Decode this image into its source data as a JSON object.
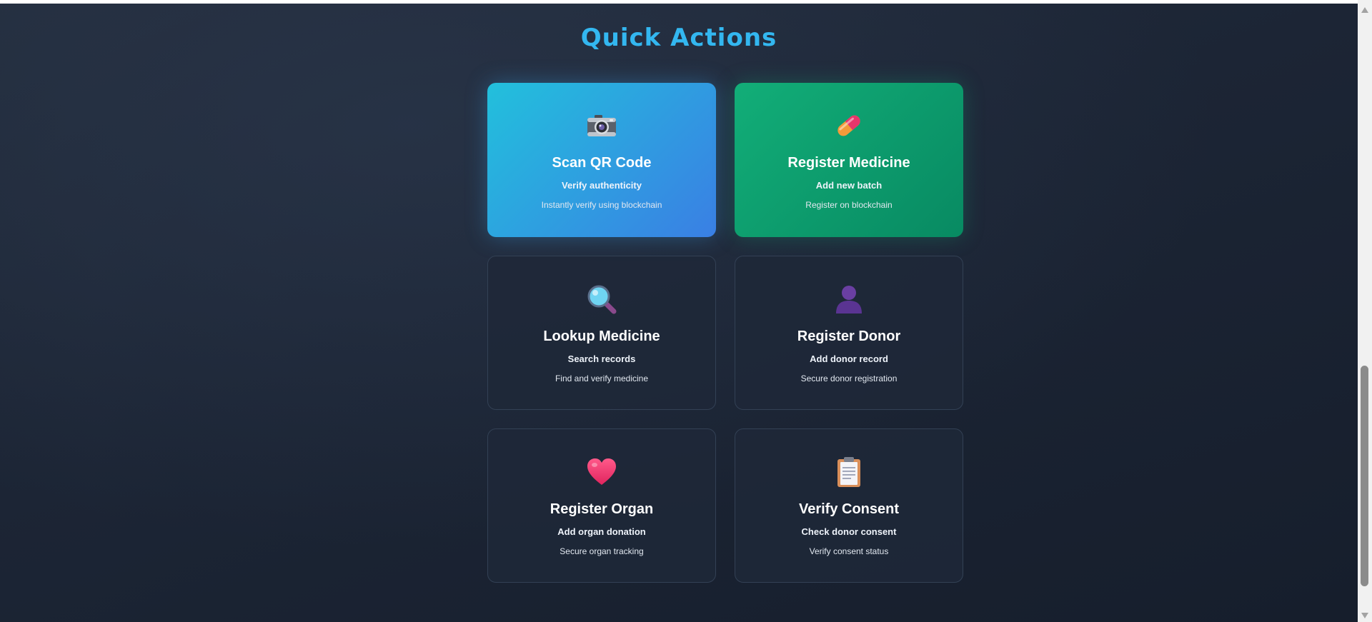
{
  "section": {
    "title": "Quick Actions"
  },
  "cards": [
    {
      "icon": "camera-icon",
      "title": "Scan QR Code",
      "subtitle": "Verify authenticity",
      "description": "Instantly verify using blockchain",
      "style": "blue-gradient"
    },
    {
      "icon": "pill-icon",
      "title": "Register Medicine",
      "subtitle": "Add new batch",
      "description": "Register on blockchain",
      "style": "green-gradient"
    },
    {
      "icon": "magnifier-icon",
      "title": "Lookup Medicine",
      "subtitle": "Search records",
      "description": "Find and verify medicine",
      "style": "plain"
    },
    {
      "icon": "person-icon",
      "title": "Register Donor",
      "subtitle": "Add donor record",
      "description": "Secure donor registration",
      "style": "plain"
    },
    {
      "icon": "heart-icon",
      "title": "Register Organ",
      "subtitle": "Add organ donation",
      "description": "Secure organ tracking",
      "style": "plain"
    },
    {
      "icon": "clipboard-icon",
      "title": "Verify Consent",
      "subtitle": "Check donor consent",
      "description": "Verify consent status",
      "style": "plain"
    }
  ],
  "colors": {
    "background": "#1c2535",
    "title": "#33b7f0",
    "card_blue_start": "#22c0dc",
    "card_blue_end": "#3a7fe4",
    "card_green_start": "#12ae78",
    "card_green_end": "#088a62",
    "card_plain": "#1e2838",
    "card_border": "#334155"
  }
}
